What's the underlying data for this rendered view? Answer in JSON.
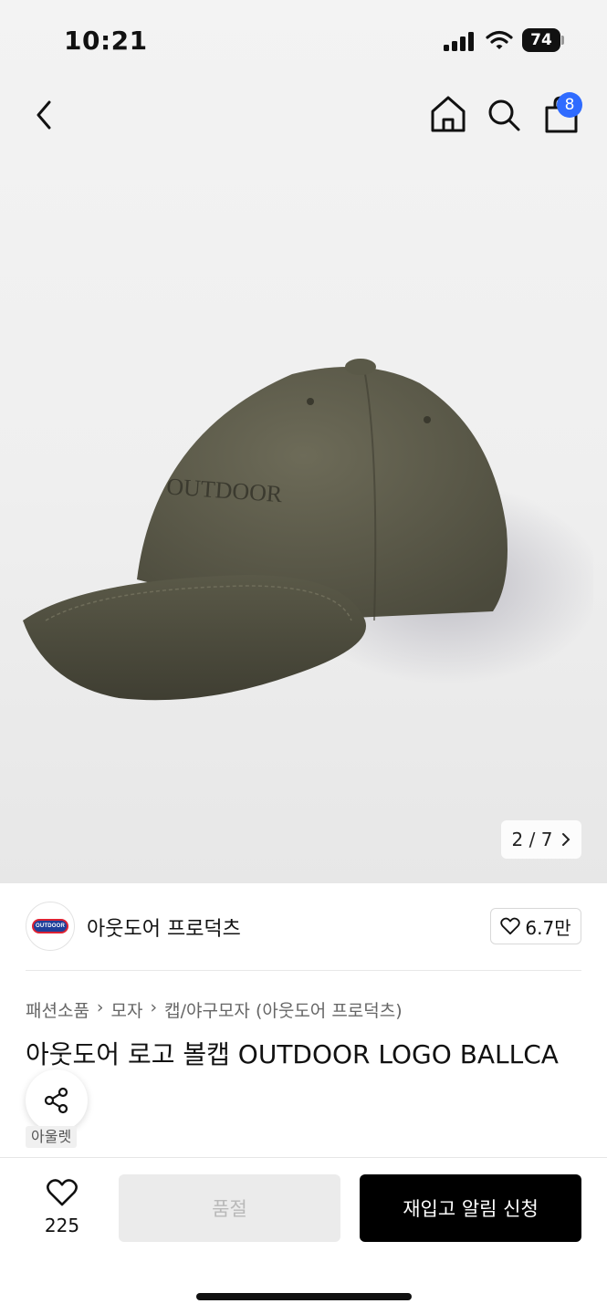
{
  "status_bar": {
    "time": "10:21",
    "battery": "74"
  },
  "nav": {
    "cart_count": "8",
    "icons": [
      "back-icon",
      "home-icon",
      "search-icon",
      "shopping-bag-icon"
    ]
  },
  "gallery": {
    "current": "2",
    "separator": "/",
    "total": "7",
    "pager_text": "2 / 7",
    "image": "olive-green baseball cap with OUTDOOR logo"
  },
  "brand": {
    "name": "아웃도어 프로덕츠",
    "logo_text": "OUTDOOR",
    "likes": "6.7만"
  },
  "breadcrumb": [
    "패션소품",
    "모자",
    "캡/야구모자 (아웃도어 프로덕츠)"
  ],
  "product": {
    "title": "아웃도어 로고 볼캡 OUTDOOR LOGO BALLCA",
    "tag": "아울렛"
  },
  "bottom_bar": {
    "wish_count": "225",
    "soldout_label": "품절",
    "notify_label": "재입고 알림 신청"
  },
  "colors": {
    "accent": "#2f6bff",
    "cap": "#5c5b4a",
    "primary_button": "#000000",
    "disabled_button": "#ebebeb"
  }
}
